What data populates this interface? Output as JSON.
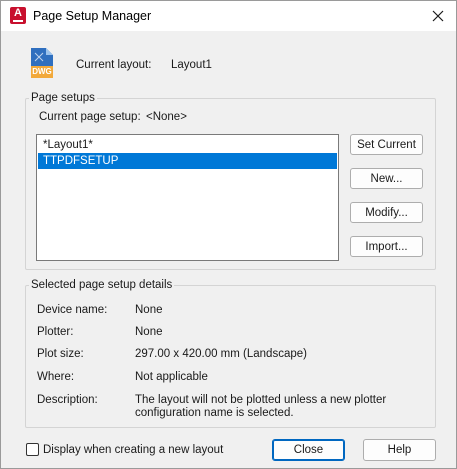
{
  "title_bar": {
    "app_icon_letter": "A",
    "title": "Page Setup Manager",
    "close_glyph": "✕"
  },
  "layout_info": {
    "icon_text": "DWG",
    "label": "Current layout:",
    "value": "Layout1"
  },
  "page_setups": {
    "legend": "Page setups",
    "current_label": "Current page setup:",
    "current_value": "<None>",
    "items": [
      {
        "label": "*Layout1*",
        "selected": false
      },
      {
        "label": "TTPDFSETUP",
        "selected": true
      }
    ],
    "buttons": {
      "set_current": "Set Current",
      "new": "New...",
      "modify": "Modify...",
      "import": "Import..."
    }
  },
  "details": {
    "legend": "Selected page setup details",
    "rows": [
      {
        "label": "Device name:",
        "value": "None"
      },
      {
        "label": "Plotter:",
        "value": "None"
      },
      {
        "label": "Plot size:",
        "value": "297.00 x 420.00 mm (Landscape)"
      },
      {
        "label": "Where:",
        "value": "Not applicable"
      },
      {
        "label": "Description:",
        "value": "The layout will not be plotted unless a new plotter",
        "value2": "configuration name is selected."
      }
    ]
  },
  "footer": {
    "checkbox_label": "Display when creating a new layout",
    "checkbox_checked": false,
    "close_button": "Close",
    "help_button": "Help"
  },
  "colors": {
    "selection": "#0078d7",
    "app_icon": "#c8102e",
    "primary_border": "#0067c0"
  }
}
